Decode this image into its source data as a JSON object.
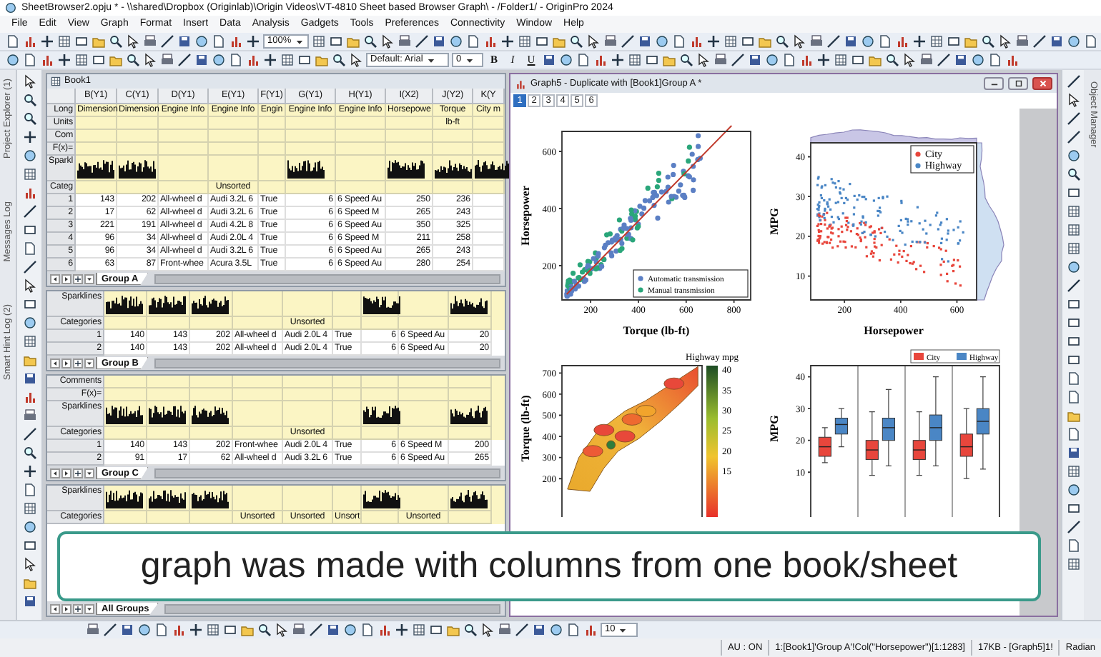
{
  "window": {
    "title": "SheetBrowser2.opju * - \\\\shared\\Dropbox (Originlab)\\Origin Videos\\VT-4810 Sheet based Browser Graph\\ - /Folder1/ - OriginPro 2024"
  },
  "menu": [
    "File",
    "Edit",
    "View",
    "Graph",
    "Format",
    "Insert",
    "Data",
    "Analysis",
    "Gadgets",
    "Tools",
    "Preferences",
    "Connectivity",
    "Window",
    "Help"
  ],
  "toolbar": {
    "zoom": "100%",
    "font": "Default: Arial",
    "font_size": "0",
    "format_buttons": [
      "B",
      "I",
      "U"
    ]
  },
  "left_panels": [
    "Project Explorer (1)",
    "Messages Log",
    "Smart Hint Log (2)"
  ],
  "right_panel": "Object Manager",
  "workbook": {
    "title": "Book1",
    "sheets": [
      {
        "columns": [
          "B(Y1)",
          "C(Y1)",
          "D(Y1)",
          "E(Y1)",
          "F(Y1)",
          "G(Y1)",
          "H(Y1)",
          "I(X2)",
          "J(Y2)",
          "K(Y"
        ],
        "label_rows": [
          {
            "label": "Long",
            "kind": "text",
            "cells": [
              "Dimension",
              "Dimension",
              "Engine Info",
              "Engine Info",
              "Engin",
              "Engine Info",
              "Engine Info",
              "Horsepowe",
              "Torque",
              "City m"
            ]
          },
          {
            "label": "Units",
            "kind": "text",
            "cells": [
              null,
              null,
              null,
              null,
              null,
              null,
              null,
              null,
              "lb-ft",
              null
            ]
          },
          {
            "label": "Com",
            "kind": "text"
          },
          {
            "label": "F(x)=",
            "kind": "text"
          },
          {
            "label": "Sparkl",
            "kind": "sparklines",
            "present": [
              true,
              true,
              false,
              false,
              false,
              true,
              false,
              true,
              true,
              true
            ]
          },
          {
            "label": "Categ",
            "kind": "text",
            "cells": [
              null,
              null,
              null,
              "Unsorted",
              null,
              null,
              null,
              null,
              null,
              null
            ]
          }
        ],
        "rows": [
          {
            "label": "1",
            "cells": [
              "143",
              "202",
              "All-wheel d",
              "Audi 3.2L 6",
              "True",
              "6",
              "6 Speed Au",
              "250",
              "236",
              null
            ]
          },
          {
            "label": "2",
            "cells": [
              "17",
              "62",
              "All-wheel d",
              "Audi 3.2L 6",
              "True",
              "6",
              "6 Speed M",
              "265",
              "243",
              null
            ]
          },
          {
            "label": "3",
            "cells": [
              "221",
              "191",
              "All-wheel d",
              "Audi 4.2L 8",
              "True",
              "6",
              "6 Speed Au",
              "350",
              "325",
              null
            ]
          },
          {
            "label": "4",
            "cells": [
              "96",
              "34",
              "All-wheel d",
              "Audi 2.0L 4",
              "True",
              "6",
              "6 Speed M",
              "211",
              "258",
              null
            ]
          },
          {
            "label": "5",
            "cells": [
              "96",
              "34",
              "All-wheel d",
              "Audi 3.2L 6",
              "True",
              "6",
              "6 Speed Au",
              "265",
              "243",
              null
            ]
          },
          {
            "label": "6",
            "cells": [
              "63",
              "87",
              "Front-whee",
              "Acura 3.5L",
              "True",
              "6",
              "6 Speed Au",
              "280",
              "254",
              null
            ]
          }
        ],
        "tab": "Group A"
      },
      {
        "label_rows": [
          {
            "label": "Sparklines",
            "kind": "sparklines",
            "present": [
              true,
              true,
              true,
              false,
              false,
              false,
              true,
              false,
              true
            ]
          },
          {
            "label": "Categories",
            "kind": "text",
            "cells": [
              null,
              null,
              null,
              null,
              "Unsorted",
              null,
              null,
              null,
              null
            ]
          }
        ],
        "rows": [
          {
            "label": "1",
            "cells": [
              "140",
              "143",
              "202",
              "All-wheel d",
              "Audi 2.0L 4",
              "True",
              "6",
              "6 Speed Au",
              "20"
            ]
          },
          {
            "label": "2",
            "cells": [
              "140",
              "143",
              "202",
              "All-wheel d",
              "Audi 2.0L 4",
              "True",
              "6",
              "6 Speed Au",
              "20"
            ]
          }
        ],
        "tab": "Group B"
      },
      {
        "label_rows": [
          {
            "label": "Comments",
            "kind": "text"
          },
          {
            "label": "F(x)=",
            "kind": "text"
          },
          {
            "label": "Sparklines",
            "kind": "sparklines",
            "present": [
              true,
              true,
              true,
              false,
              false,
              false,
              true,
              false,
              true
            ]
          },
          {
            "label": "Categories",
            "kind": "text",
            "cells": [
              null,
              null,
              null,
              null,
              "Unsorted",
              null,
              null,
              null,
              null
            ]
          }
        ],
        "rows": [
          {
            "label": "1",
            "cells": [
              "140",
              "143",
              "202",
              "Front-whee",
              "Audi 2.0L 4",
              "True",
              "6",
              "6 Speed M",
              "200"
            ]
          },
          {
            "label": "2",
            "cells": [
              "91",
              "17",
              "62",
              "All-wheel d",
              "Audi 3.2L 6",
              "True",
              "6",
              "6 Speed Au",
              "265"
            ]
          }
        ],
        "tab": "Group C"
      },
      {
        "label_rows": [
          {
            "label": "Sparklines",
            "kind": "sparklines",
            "present": [
              true,
              true,
              true,
              false,
              false,
              false,
              true,
              false,
              true
            ]
          },
          {
            "label": "Categories",
            "kind": "text",
            "cells": [
              null,
              null,
              null,
              "Unsorted",
              "Unsorted",
              "Unsort",
              null,
              "Unsorted",
              null
            ]
          }
        ],
        "tab": "All Groups"
      }
    ]
  },
  "graph": {
    "title": "Graph5 - Duplicate with [Book1]Group A *",
    "pages": [
      {
        "label": "1",
        "selected": true
      },
      {
        "label": "2",
        "selected": false
      },
      {
        "label": "3",
        "selected": false
      },
      {
        "label": "4",
        "selected": false
      },
      {
        "label": "5",
        "selected": false
      },
      {
        "label": "6",
        "selected": false
      }
    ],
    "plots": [
      {
        "kind": "scatter_fit",
        "xlabel": "Torque (lb-ft)",
        "ylabel": "Horsepower",
        "yticks": [
          "600",
          "400",
          "200"
        ],
        "xticks": [
          "200",
          "400",
          "600",
          "800"
        ],
        "legend": [
          {
            "label": "Automatic transmission",
            "color": "#5b7fc4"
          },
          {
            "label": "Manual transmission",
            "color": "#2aa67a"
          }
        ]
      },
      {
        "kind": "scatter_marginal",
        "xlabel": "Horsepower",
        "ylabel": "MPG",
        "yticks": [
          "40",
          "30",
          "20",
          "10"
        ],
        "xticks": [
          "200",
          "400",
          "600"
        ],
        "legend": [
          {
            "label": "City",
            "color": "#e8463c"
          },
          {
            "label": "Highway",
            "color": "#4a86c5"
          }
        ]
      },
      {
        "kind": "contour",
        "ylabel": "Torque (lb-ft)",
        "yticks": [
          "700",
          "600",
          "500",
          "400",
          "300",
          "200"
        ],
        "colorbar": {
          "title": "Highway mpg",
          "ticks": [
            "40",
            "35",
            "30",
            "25",
            "20",
            "15"
          ]
        }
      },
      {
        "kind": "box",
        "ylabel": "MPG",
        "yticks": [
          "40",
          "30",
          "20",
          "10"
        ],
        "legend": [
          {
            "label": "City",
            "color": "#e8463c"
          },
          {
            "label": "Highway",
            "color": "#4a86c5"
          }
        ]
      }
    ]
  },
  "caption": "graph was made with columns from one book/sheet",
  "bottom_toolbar": {
    "size": "10"
  },
  "status_bar": [
    "AU : ON",
    "1:[Book1]'Group A'!Col(\"Horsepower\")[1:1283]",
    "17KB - [Graph5]1!",
    "Radian"
  ]
}
